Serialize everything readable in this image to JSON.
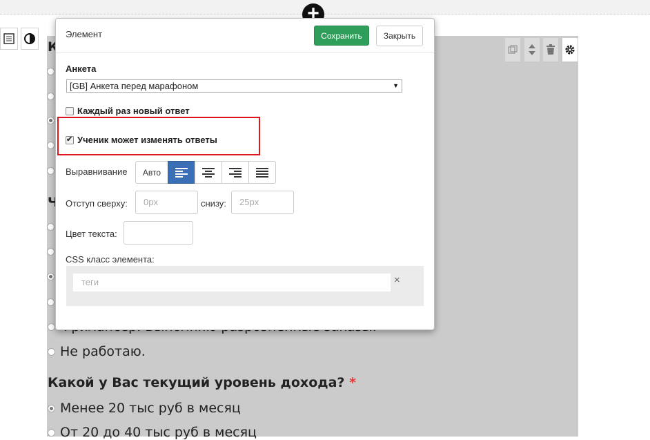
{
  "page": {
    "add_icon": "plus-icon"
  },
  "side_tools": [
    {
      "icon": "form-icon",
      "glyph": "▤"
    },
    {
      "icon": "contrast-icon",
      "glyph": "◐"
    }
  ],
  "block_tools": [
    {
      "icon": "copy-icon",
      "glyph": "❐"
    },
    {
      "icon": "move-updown-icon",
      "glyph": "⬍"
    },
    {
      "icon": "trash-icon",
      "glyph": "🗑"
    },
    {
      "icon": "gear-icon",
      "glyph": "⚙"
    }
  ],
  "survey": {
    "edge_letters": [
      "К",
      "Ч"
    ],
    "partial_option": "Фрилансер. Выполняю разрозненные заказы.",
    "option_no_work": "Не работаю.",
    "question_income": "Какой у Вас текущий уровень дохода?",
    "required_mark": "*",
    "income_options": [
      "Менее 20 тыс руб в месяц",
      "От 20 до 40 тыс руб в месяц"
    ]
  },
  "modal": {
    "title": "Элемент",
    "save_label": "Сохранить",
    "close_label": "Закрыть",
    "form_label": "Анкета",
    "form_selected": "[GB] Анкета перед марафоном",
    "new_answer_label": "Каждый раз новый ответ",
    "new_answer_checked": false,
    "can_edit_label": "Ученик может изменять ответы",
    "can_edit_checked": true,
    "align_label": "Выравнивание",
    "align_options": [
      "Авто",
      "left",
      "center",
      "right",
      "justify"
    ],
    "align_selected": "left",
    "margin_top_label": "Отступ сверху:",
    "margin_top_placeholder": "0px",
    "margin_bottom_label": "снизу:",
    "margin_bottom_placeholder": "25px",
    "text_color_label": "Цвет текста:",
    "css_class_label": "CSS класс элемента:",
    "tags_placeholder": "теги",
    "tags_clear": "×"
  },
  "colors": {
    "save_button": "#2f9e5a",
    "active_align": "#3a6fb5",
    "highlight_border": "#e0141c",
    "panel_grey": "#cbcbcb"
  }
}
